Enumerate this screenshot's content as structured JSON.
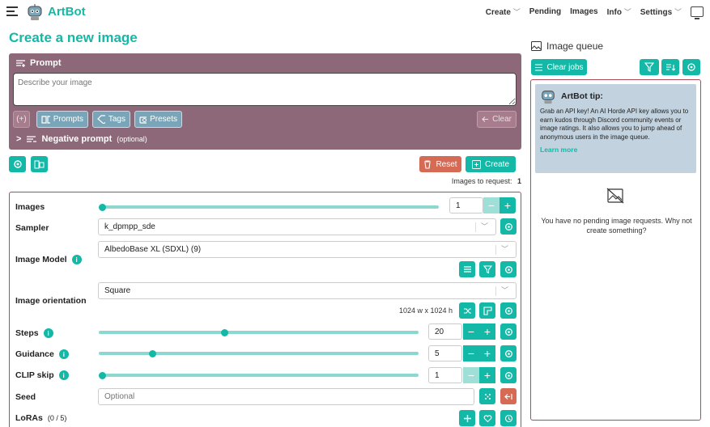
{
  "header": {
    "brand": "ArtBot",
    "nav": [
      {
        "label": "Create",
        "dropdown": true
      },
      {
        "label": "Pending",
        "dropdown": false
      },
      {
        "label": "Images",
        "dropdown": false
      },
      {
        "label": "Info",
        "dropdown": true
      },
      {
        "label": "Settings",
        "dropdown": true
      }
    ],
    "chev": "﹀"
  },
  "page_title": "Create a new image",
  "prompt": {
    "heading": "Prompt",
    "placeholder": "Describe your image",
    "brace_label": "(+)",
    "prompts_label": "Prompts",
    "tags_label": "Tags",
    "presets_label": "Presets",
    "clear_label": "Clear",
    "negative_label": "Negative prompt",
    "negative_optional": "(optional)"
  },
  "actions": {
    "reset_label": "Reset",
    "create_label": "Create",
    "images_to_request_label": "Images to request:",
    "images_to_request_value": "1"
  },
  "settings": {
    "images": {
      "label": "Images",
      "value": "1",
      "level": 0.0
    },
    "sampler": {
      "label": "Sampler",
      "value": "k_dpmpp_sde"
    },
    "image_model": {
      "label": "Image Model",
      "value": "AlbedoBase XL (SDXL) (9)"
    },
    "image_orientation": {
      "label": "Image orientation",
      "value": "Square",
      "dims": "1024 w x 1024 h"
    },
    "steps": {
      "label": "Steps",
      "value": "20",
      "level": 0.39
    },
    "guidance": {
      "label": "Guidance",
      "value": "5",
      "level": 0.16
    },
    "clip_skip": {
      "label": "CLIP skip",
      "value": "1",
      "level": 0.0
    },
    "seed": {
      "label": "Seed",
      "placeholder": "Optional"
    },
    "loras": {
      "label": "LoRAs",
      "count": "(0 / 5)"
    }
  },
  "queue": {
    "title": "Image queue",
    "clear_jobs_label": "Clear jobs",
    "tip_title": "ArtBot tip:",
    "tip_body": "Grab an API key! An AI Horde API key allows you to earn kudos through Discord community events or image ratings. It also allows you to jump ahead of anonymous users in the image queue.",
    "tip_link": "Learn more",
    "empty_text": "You have no pending image requests. Why not create something?"
  },
  "colors": {
    "accent": "#14b8a6",
    "prompt_panel": "#8c6878",
    "danger": "#d56a55",
    "tip_bg": "#c2d3df"
  }
}
